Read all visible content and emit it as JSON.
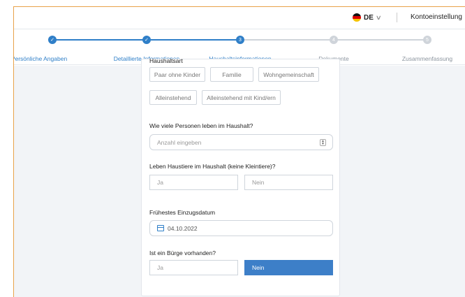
{
  "header": {
    "language": "DE",
    "account_label": "Kontoeinstellung"
  },
  "stepper": {
    "steps": [
      {
        "label": "Persönliche Angaben",
        "number": "1",
        "state": "done"
      },
      {
        "label": "Detaillierte Informationen",
        "number": "2",
        "state": "done"
      },
      {
        "label": "Haushaltsinformationen",
        "number": "3",
        "state": "active"
      },
      {
        "label": "Dokumente",
        "number": "4",
        "state": "todo"
      },
      {
        "label": "Zusammenfassung",
        "number": "5",
        "state": "todo"
      }
    ]
  },
  "form": {
    "household_type": {
      "label": "Haushaltsart",
      "options": [
        "Paar ohne Kinder",
        "Familie",
        "Wohngemeinschaft",
        "Alleinstehend",
        "Alleinstehend mit Kind/ern"
      ]
    },
    "persons": {
      "label": "Wie viele Personen leben im Haushalt?",
      "placeholder": "Anzahl eingeben"
    },
    "pets": {
      "label": "Leben Haustiere im Haushalt (keine Kleintiere)?",
      "yes": "Ja",
      "no": "Nein"
    },
    "move_in": {
      "label": "Frühestes Einzugsdatum",
      "value": "04.10.2022"
    },
    "guarantor": {
      "label": "Ist ein Bürge vorhanden?",
      "yes": "Ja",
      "no": "Nein",
      "selected": "no"
    }
  },
  "colors": {
    "accent": "#2f7fc8",
    "selected_button": "#3d7fc8",
    "inactive_step": "#cfd4da",
    "frame_border": "#e8a24a"
  }
}
